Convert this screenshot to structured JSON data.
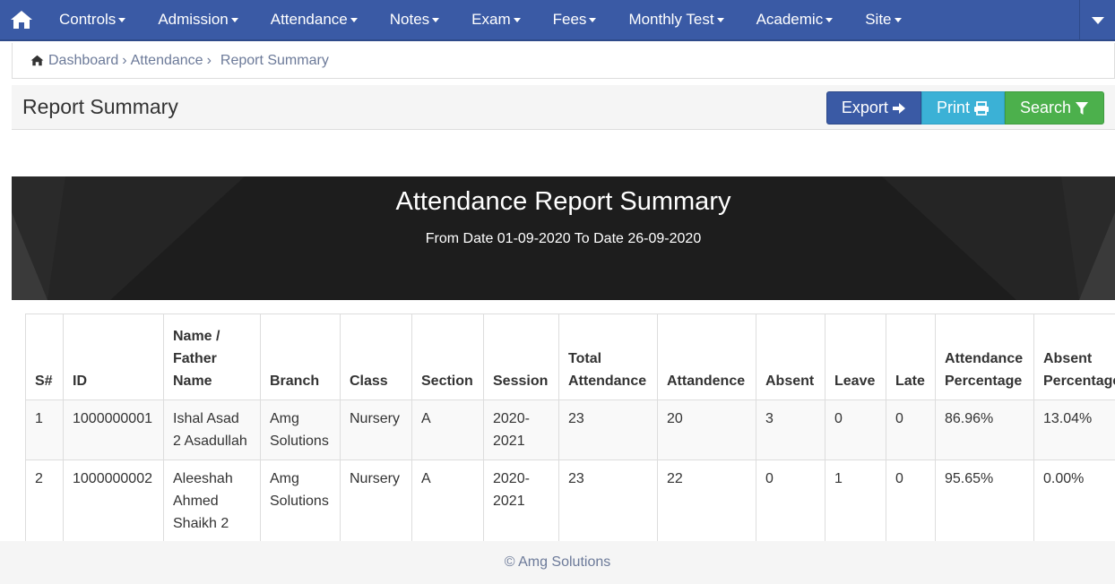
{
  "nav": {
    "items": [
      {
        "label": "Controls"
      },
      {
        "label": "Admission"
      },
      {
        "label": "Attendance"
      },
      {
        "label": "Notes"
      },
      {
        "label": "Exam"
      },
      {
        "label": "Fees"
      },
      {
        "label": "Monthly Test"
      },
      {
        "label": "Academic"
      },
      {
        "label": "Site"
      }
    ],
    "home_icon": "home-icon",
    "accent": "#3a5aa5"
  },
  "breadcrumb": {
    "items": [
      "Dashboard",
      "Attendance",
      "Report Summary"
    ],
    "separator": "›"
  },
  "panel": {
    "title": "Report Summary",
    "export_label": "Export",
    "print_label": "Print",
    "search_label": "Search"
  },
  "report": {
    "title": "Attendance Report Summary",
    "subtitle": "From Date 01-09-2020 To Date 26-09-2020"
  },
  "table": {
    "headers": [
      "S#",
      "ID",
      "Name / Father Name",
      "Branch",
      "Class",
      "Section",
      "Session",
      "Total Attendance",
      "Attandence",
      "Absent",
      "Leave",
      "Late",
      "Attendance Percentage",
      "Absent Percentage"
    ],
    "rows": [
      [
        "1",
        "1000000001",
        "Ishal Asad 2 Asadullah",
        "Amg Solutions",
        "Nursery",
        "A",
        "2020-2021",
        "23",
        "20",
        "3",
        "0",
        "0",
        "86.96%",
        "13.04%"
      ],
      [
        "2",
        "1000000002",
        "Aleeshah Ahmed Shaikh 2",
        "Amg Solutions",
        "Nursery",
        "A",
        "2020-2021",
        "23",
        "22",
        "0",
        "1",
        "0",
        "95.65%",
        "0.00%"
      ]
    ]
  },
  "footer": {
    "text": "© Amg Solutions"
  }
}
